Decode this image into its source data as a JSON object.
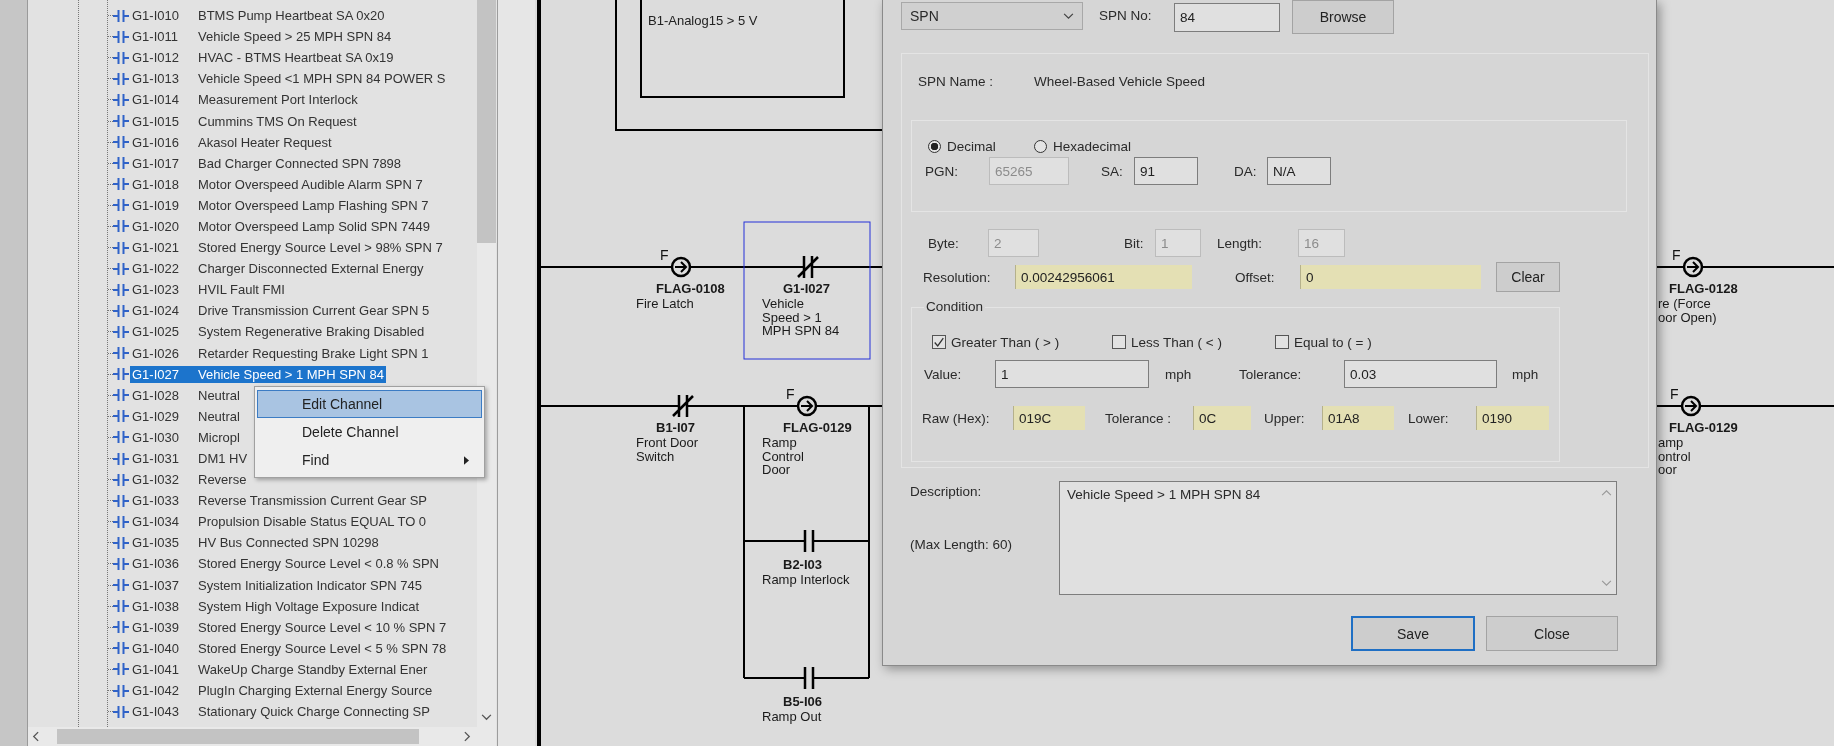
{
  "tree": {
    "items": [
      {
        "code": "G1-I010",
        "label": "BTMS Pump Heartbeat SA 0x20",
        "selected": false
      },
      {
        "code": "G1-I011",
        "label": "Vehicle Speed > 25 MPH SPN 84",
        "selected": false
      },
      {
        "code": "G1-I012",
        "label": "HVAC - BTMS Heartbeat SA 0x19",
        "selected": false
      },
      {
        "code": "G1-I013",
        "label": "Vehicle Speed <1 MPH SPN 84 POWER S",
        "selected": false
      },
      {
        "code": "G1-I014",
        "label": "Measurement Port Interlock",
        "selected": false
      },
      {
        "code": "G1-I015",
        "label": "Cummins TMS On Request",
        "selected": false
      },
      {
        "code": "G1-I016",
        "label": "Akasol Heater Request",
        "selected": false
      },
      {
        "code": "G1-I017",
        "label": "Bad Charger Connected SPN 7898",
        "selected": false
      },
      {
        "code": "G1-I018",
        "label": "Motor Overspeed Audible Alarm SPN 7",
        "selected": false
      },
      {
        "code": "G1-I019",
        "label": "Motor Overspeed Lamp Flashing SPN 7",
        "selected": false
      },
      {
        "code": "G1-I020",
        "label": "Motor Overspeed Lamp Solid SPN 7449",
        "selected": false
      },
      {
        "code": "G1-I021",
        "label": "Stored Energy Source Level > 98% SPN 7",
        "selected": false
      },
      {
        "code": "G1-I022",
        "label": "Charger Disconnected External Energy",
        "selected": false
      },
      {
        "code": "G1-I023",
        "label": "HVIL Fault FMI",
        "selected": false
      },
      {
        "code": "G1-I024",
        "label": "Drive Transmission Current Gear SPN 5",
        "selected": false
      },
      {
        "code": "G1-I025",
        "label": "System Regenerative Braking Disabled",
        "selected": false
      },
      {
        "code": "G1-I026",
        "label": "Retarder Requesting Brake Light SPN 1",
        "selected": false
      },
      {
        "code": "G1-I027",
        "label": "Vehicle Speed > 1 MPH SPN 84",
        "selected": true
      },
      {
        "code": "G1-I028",
        "label": "Neutral",
        "selected": false
      },
      {
        "code": "G1-I029",
        "label": "Neutral",
        "selected": false
      },
      {
        "code": "G1-I030",
        "label": "Micropl",
        "selected": false
      },
      {
        "code": "G1-I031",
        "label": "DM1 HV",
        "selected": false
      },
      {
        "code": "G1-I032",
        "label": "Reverse",
        "selected": false
      },
      {
        "code": "G1-I033",
        "label": "Reverse Transmission Current Gear SP",
        "selected": false
      },
      {
        "code": "G1-I034",
        "label": "Propulsion Disable Status EQUAL TO 0",
        "selected": false
      },
      {
        "code": "G1-I035",
        "label": "HV Bus Connected SPN 10298",
        "selected": false
      },
      {
        "code": "G1-I036",
        "label": "Stored Energy Source Level < 0.8 % SPN",
        "selected": false
      },
      {
        "code": "G1-I037",
        "label": "System Initialization Indicator SPN 745",
        "selected": false
      },
      {
        "code": "G1-I038",
        "label": "System High Voltage Exposure Indicat",
        "selected": false
      },
      {
        "code": "G1-I039",
        "label": "Stored Energy Source Level < 10 % SPN 7",
        "selected": false
      },
      {
        "code": "G1-I040",
        "label": "Stored Energy Source Level < 5 % SPN 78",
        "selected": false
      },
      {
        "code": "G1-I041",
        "label": "WakeUp Charge Standby External Ener",
        "selected": false
      },
      {
        "code": "G1-I042",
        "label": "PlugIn Charging External Energy Source",
        "selected": false
      },
      {
        "code": "G1-I043",
        "label": "Stationary Quick Charge Connecting SP",
        "selected": false
      }
    ]
  },
  "context_menu": {
    "items": [
      {
        "label": "Edit Channel",
        "selected": true,
        "submenu": false
      },
      {
        "label": "Delete Channel",
        "selected": false,
        "submenu": false
      },
      {
        "label": "Find",
        "selected": false,
        "submenu": true
      }
    ]
  },
  "ladder": {
    "function_block": {
      "text": "B1-Analog15 > 5 V"
    },
    "elements": [
      {
        "kind": "coil",
        "letter": "F",
        "tag": "FLAG-0108",
        "lines": [
          "Fire Latch"
        ],
        "selected": false
      },
      {
        "kind": "nc_contact",
        "tag": "G1-I027",
        "lines": [
          "Vehicle",
          "Speed > 1",
          "MPH SPN 84"
        ],
        "selected": true
      },
      {
        "kind": "nc_contact",
        "tag": "B1-I07",
        "lines": [
          "Front Door",
          "Switch"
        ],
        "selected": false
      },
      {
        "kind": "coil",
        "letter": "F",
        "tag": "FLAG-0129",
        "lines": [
          "Ramp",
          "Control",
          "Door"
        ],
        "selected": false
      },
      {
        "kind": "no_contact",
        "tag": "B2-I03",
        "lines": [
          "Ramp Interlock"
        ],
        "selected": false
      },
      {
        "kind": "no_contact",
        "tag": "B5-I06",
        "lines": [
          "Ramp Out"
        ],
        "selected": false
      },
      {
        "kind": "coil",
        "letter": "F",
        "tag": "FLAG-0128",
        "lines": [
          "re (Force",
          "oor Open)"
        ],
        "selected": false
      },
      {
        "kind": "coil",
        "letter": "F",
        "tag": "FLAG-0129",
        "lines": [
          "amp",
          "ontrol",
          "oor"
        ],
        "selected": false
      }
    ]
  },
  "dialog": {
    "type_select": {
      "value": "SPN"
    },
    "spn_no": {
      "label": "SPN No:",
      "value": "84"
    },
    "browse_button": "Browse",
    "spn_name": {
      "label": "SPN Name :",
      "value": "Wheel-Based Vehicle Speed"
    },
    "format_options": [
      {
        "label": "Decimal",
        "selected": true
      },
      {
        "label": "Hexadecimal",
        "selected": false
      }
    ],
    "address_fields": [
      {
        "label": "PGN:",
        "value": "65265",
        "disabled": true
      },
      {
        "label": "SA:",
        "value": "91",
        "disabled": false
      },
      {
        "label": "DA:",
        "value": "N/A",
        "disabled": false
      }
    ],
    "bit_fields": [
      {
        "label": "Byte:",
        "value": "2",
        "disabled": true
      },
      {
        "label": "Bit:",
        "value": "1",
        "disabled": true
      },
      {
        "label": "Length:",
        "value": "16",
        "disabled": true
      }
    ],
    "scaling_fields": [
      {
        "label": "Resolution:",
        "value": "0.00242956061"
      },
      {
        "label": "Offset:",
        "value": "0"
      }
    ],
    "clear_button": "Clear",
    "condition": {
      "title": "Condition",
      "options": [
        {
          "label": "Greater Than ( > )",
          "checked": true
        },
        {
          "label": "Less Than ( < )",
          "checked": false
        },
        {
          "label": "Equal to ( = )",
          "checked": false
        }
      ],
      "value_fields": [
        {
          "label": "Value:",
          "value": "1",
          "unit": "mph"
        },
        {
          "label": "Tolerance:",
          "value": "0.03",
          "unit": "mph"
        }
      ],
      "raw_fields": [
        {
          "label": "Raw (Hex):",
          "value": "019C"
        },
        {
          "label": "Tolerance :",
          "value": "0C"
        },
        {
          "label": "Upper:",
          "value": "01A8"
        },
        {
          "label": "Lower:",
          "value": "0190"
        }
      ]
    },
    "description": {
      "label": "Description:",
      "hint": "(Max Length: 60)",
      "value": "Vehicle Speed > 1 MPH SPN 84"
    },
    "buttons": [
      {
        "label": "Save",
        "focused": true
      },
      {
        "label": "Close",
        "focused": false
      }
    ]
  }
}
